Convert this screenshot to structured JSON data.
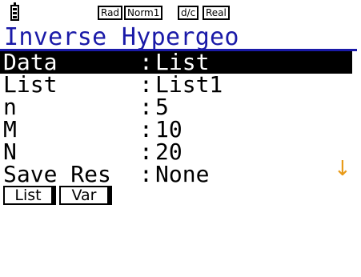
{
  "status": {
    "battery_icon": "battery-icon",
    "badges": [
      "Rad",
      "Norm1",
      "d/c",
      "Real"
    ]
  },
  "title": "Inverse Hypergeo",
  "rows": [
    {
      "label": "Data",
      "colon": ":",
      "value": "List",
      "selected": true
    },
    {
      "label": "List",
      "colon": ":",
      "value": "List1",
      "selected": false
    },
    {
      "label": "n",
      "colon": ":",
      "value": "5",
      "selected": false
    },
    {
      "label": "M",
      "colon": ":",
      "value": "10",
      "selected": false
    },
    {
      "label": "N",
      "colon": ":",
      "value": "20",
      "selected": false
    },
    {
      "label": "Save Res",
      "colon": ":",
      "value": "None",
      "selected": false
    }
  ],
  "scroll_indicator": {
    "icon": "arrow-down-icon",
    "glyph": "↓",
    "color": "#e89a18"
  },
  "function_keys": [
    "List",
    "Var"
  ],
  "colors": {
    "title": "#1a1aa8",
    "selection": "#000000"
  }
}
